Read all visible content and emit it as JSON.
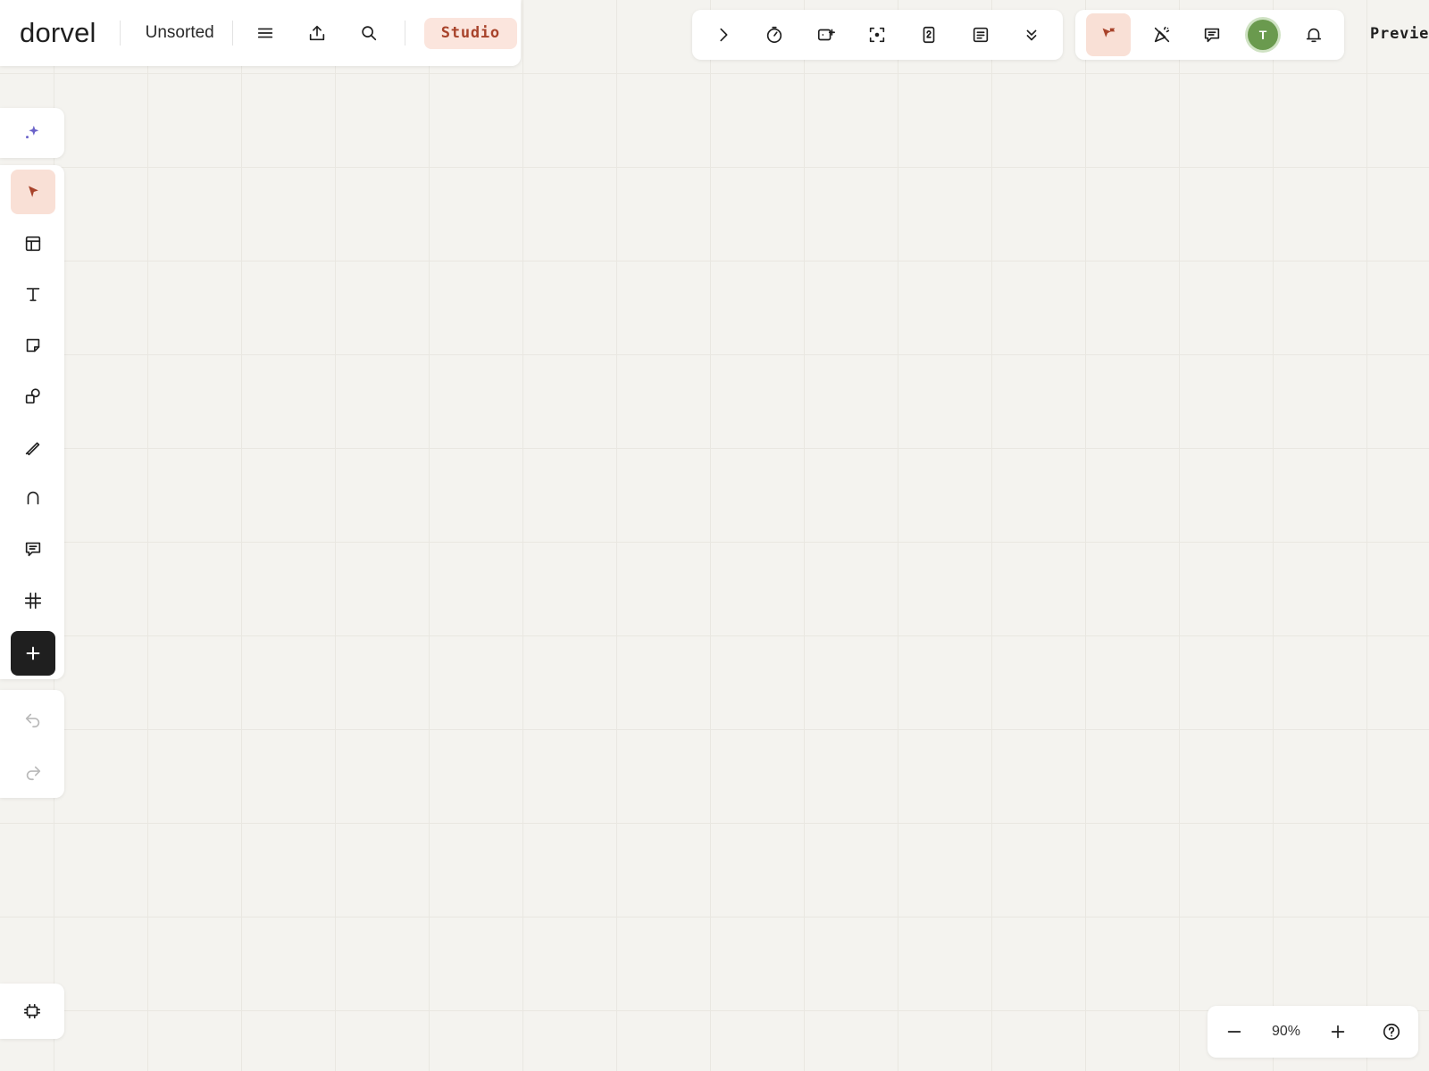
{
  "app": {
    "logo_text": "dorvel",
    "board_name": "Unsorted",
    "studio_label": "Studio",
    "preview_label": "Preview"
  },
  "top_left_toolbar": [
    "menu-icon",
    "export-icon",
    "search-icon"
  ],
  "top_center_toolbar": [
    "chevron-right-icon",
    "timer-icon",
    "video-add-icon",
    "focus-icon",
    "page-number-icon",
    "notes-icon",
    "chevron-double-down-icon"
  ],
  "top_right_toolbar": {
    "items": [
      "cursor-flag-icon",
      "reactions-off-icon",
      "comment-icon",
      "avatar",
      "bell-icon"
    ],
    "avatar_initial": "T",
    "avatar_color": "#6a9a4e"
  },
  "left_toolbar": {
    "ai": "sparkle-icon",
    "tools": [
      "select-tool",
      "table-tool",
      "text-tool",
      "sticky-note-tool",
      "shapes-tool",
      "pen-tool",
      "connector-tool",
      "comment-tool",
      "grid-tool",
      "add-tool"
    ],
    "active_tool": "select-tool",
    "history": [
      "undo-icon",
      "redo-icon"
    ],
    "bottom": "frames-icon"
  },
  "zoom": {
    "level": "90%"
  },
  "colors": {
    "accent": "#a8432b",
    "accent_bg": "#f9e0d6",
    "canvas": "#f4f3ef",
    "dark": "#1f1f1f"
  }
}
